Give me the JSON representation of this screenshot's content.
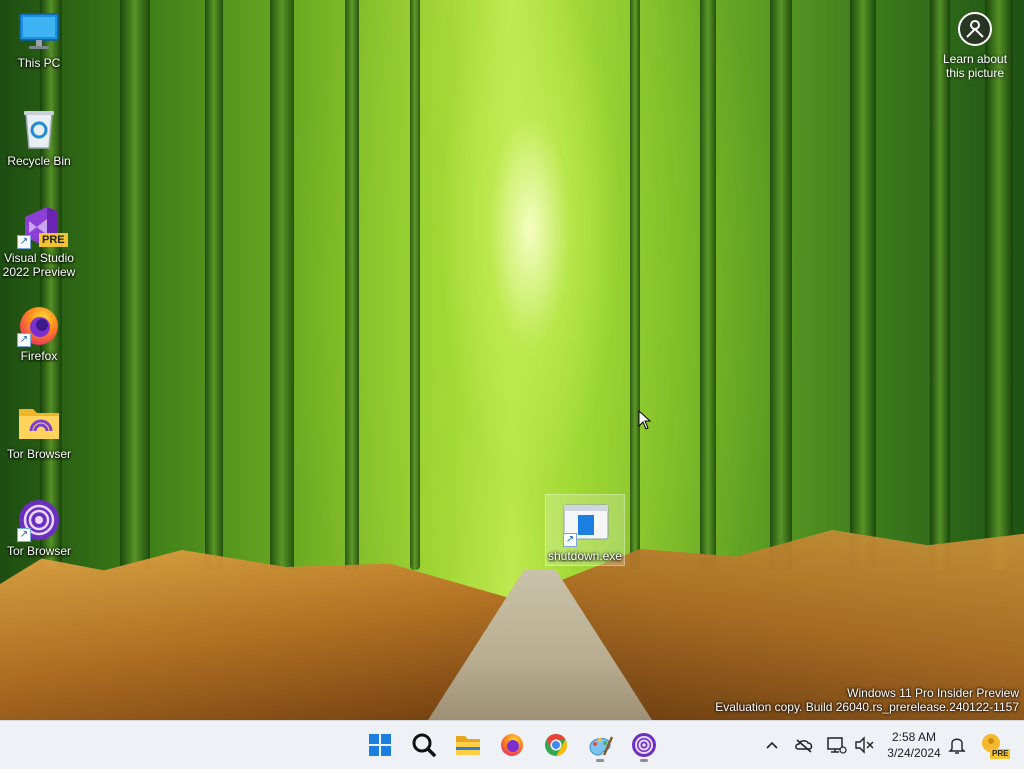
{
  "desktop": {
    "icons": [
      {
        "label": "This PC",
        "icon": "this-pc-icon"
      },
      {
        "label": "Recycle Bin",
        "icon": "recycle-bin-icon"
      },
      {
        "label": "Visual Studio 2022 Preview",
        "badge": "PRE",
        "icon": "visual-studio-icon"
      },
      {
        "label": "Firefox",
        "icon": "firefox-icon"
      },
      {
        "label": "Tor Browser",
        "icon": "tor-folder-icon"
      },
      {
        "label": "Tor Browser",
        "icon": "tor-browser-icon"
      },
      {
        "label": "shutdown.exe",
        "icon": "shutdown-exe-icon",
        "selected": true
      }
    ],
    "learn_about_picture": "Learn about this picture"
  },
  "watermark": {
    "line1": "Windows 11 Pro Insider Preview",
    "line2": "Evaluation copy. Build 26040.rs_prerelease.240122-1157"
  },
  "taskbar": {
    "pinned": [
      {
        "name": "start",
        "icon": "windows-start-icon"
      },
      {
        "name": "search",
        "icon": "search-icon"
      },
      {
        "name": "file-explorer",
        "icon": "folder-icon"
      },
      {
        "name": "firefox",
        "icon": "firefox-icon"
      },
      {
        "name": "chrome",
        "icon": "chrome-icon"
      },
      {
        "name": "paint",
        "icon": "paint-icon",
        "running": true
      },
      {
        "name": "tor-browser",
        "icon": "tor-browser-icon",
        "running": true
      }
    ],
    "tray": {
      "clock_time": "2:58 AM",
      "clock_date": "3/24/2024",
      "badge": "PRE"
    }
  },
  "colors": {
    "taskbar_bg": "#eef1f6",
    "start_blue": "#1a7fe0",
    "tor_purple": "#6b2fbf"
  }
}
